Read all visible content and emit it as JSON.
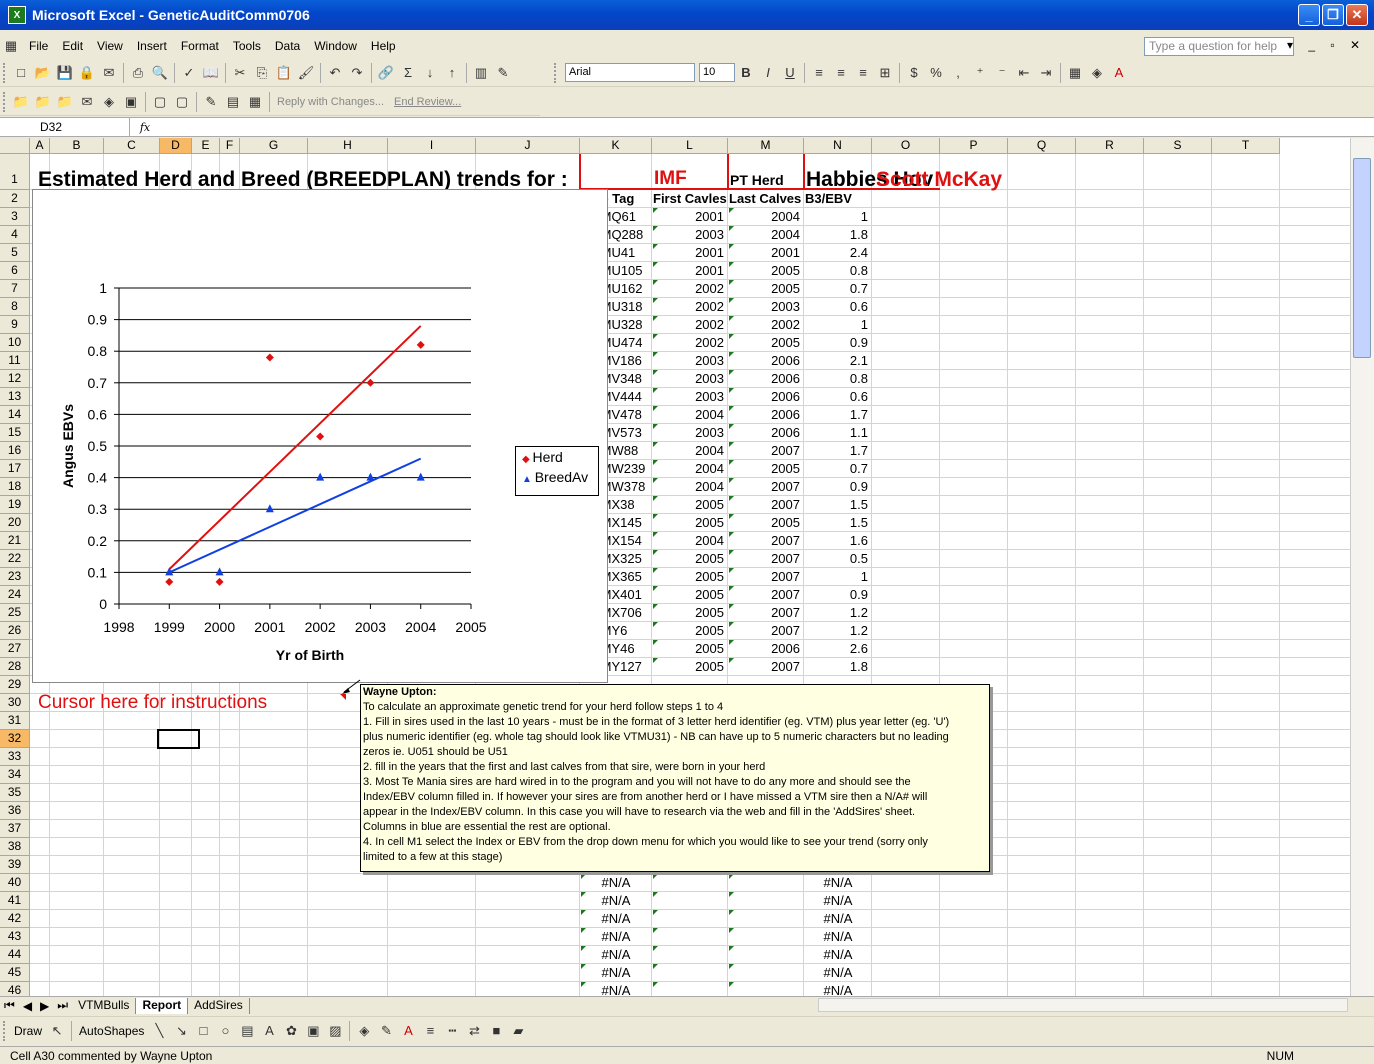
{
  "window": {
    "title": "Microsoft Excel - GeneticAuditComm0706"
  },
  "menu": [
    "File",
    "Edit",
    "View",
    "Insert",
    "Format",
    "Tools",
    "Data",
    "Window",
    "Help"
  ],
  "help_placeholder": "Type a question for help",
  "toolbar": {
    "font": "Arial",
    "size": "10",
    "reply_label": "Reply with Changes...",
    "end_review_label": "End Review..."
  },
  "formula": {
    "cell": "D32",
    "fx": "fx",
    "content": ""
  },
  "columns": [
    "A",
    "B",
    "C",
    "D",
    "E",
    "F",
    "G",
    "H",
    "I",
    "J",
    "K",
    "L",
    "M",
    "N",
    "O",
    "P",
    "Q",
    "R",
    "S",
    "T"
  ],
  "row_numbers": [
    "1",
    "2",
    "3",
    "4",
    "5",
    "6",
    "7",
    "8",
    "9",
    "10",
    "11",
    "12",
    "13",
    "14",
    "15",
    "16",
    "17",
    "18",
    "19",
    "20",
    "21",
    "22",
    "23",
    "24",
    "25",
    "26",
    "27",
    "28",
    "29",
    "30",
    "31",
    "32",
    "33",
    "34",
    "35",
    "36",
    "37",
    "38",
    "39",
    "40",
    "41",
    "42",
    "43",
    "44",
    "45",
    "46"
  ],
  "header_row": {
    "title": "Estimated Herd and Breed (BREEDPLAN) trends for :",
    "trait": "IMF",
    "pt_herd": "PT Herd",
    "herd_name": "Habbies Hov",
    "owner": "Scott McKay"
  },
  "row2": {
    "imf_small": "IMF",
    "sire_tag": "Sire Tag",
    "first": "First Cavles",
    "last": "Last Calves",
    "ebv": "B3/EBV"
  },
  "sires": [
    {
      "tag": "VTMQ61",
      "first": "2001",
      "last": "2004",
      "ebv": "1"
    },
    {
      "tag": "VTMQ288",
      "first": "2003",
      "last": "2004",
      "ebv": "1.8"
    },
    {
      "tag": "VTMU41",
      "first": "2001",
      "last": "2001",
      "ebv": "2.4"
    },
    {
      "tag": "VTMU105",
      "first": "2001",
      "last": "2005",
      "ebv": "0.8"
    },
    {
      "tag": "VTMU162",
      "first": "2002",
      "last": "2005",
      "ebv": "0.7"
    },
    {
      "tag": "VTMU318",
      "first": "2002",
      "last": "2003",
      "ebv": "0.6"
    },
    {
      "tag": "VTMU328",
      "first": "2002",
      "last": "2002",
      "ebv": "1"
    },
    {
      "tag": "VTMU474",
      "first": "2002",
      "last": "2005",
      "ebv": "0.9"
    },
    {
      "tag": "VTMV186",
      "first": "2003",
      "last": "2006",
      "ebv": "2.1"
    },
    {
      "tag": "VTMV348",
      "first": "2003",
      "last": "2006",
      "ebv": "0.8"
    },
    {
      "tag": "VTMV444",
      "first": "2003",
      "last": "2006",
      "ebv": "0.6"
    },
    {
      "tag": "VTMV478",
      "first": "2004",
      "last": "2006",
      "ebv": "1.7"
    },
    {
      "tag": "VTMV573",
      "first": "2003",
      "last": "2006",
      "ebv": "1.1"
    },
    {
      "tag": "VTMW88",
      "first": "2004",
      "last": "2007",
      "ebv": "1.7"
    },
    {
      "tag": "VTMW239",
      "first": "2004",
      "last": "2005",
      "ebv": "0.7"
    },
    {
      "tag": "VTMW378",
      "first": "2004",
      "last": "2007",
      "ebv": "0.9"
    },
    {
      "tag": "VTMX38",
      "first": "2005",
      "last": "2007",
      "ebv": "1.5"
    },
    {
      "tag": "VTMX145",
      "first": "2005",
      "last": "2005",
      "ebv": "1.5"
    },
    {
      "tag": "VTMX154",
      "first": "2004",
      "last": "2007",
      "ebv": "1.6"
    },
    {
      "tag": "VTMX325",
      "first": "2005",
      "last": "2007",
      "ebv": "0.5"
    },
    {
      "tag": "VTMX365",
      "first": "2005",
      "last": "2007",
      "ebv": "1"
    },
    {
      "tag": "VTMX401",
      "first": "2005",
      "last": "2007",
      "ebv": "0.9"
    },
    {
      "tag": "VTMX706",
      "first": "2005",
      "last": "2007",
      "ebv": "1.2"
    },
    {
      "tag": "VTMY6",
      "first": "2005",
      "last": "2007",
      "ebv": "1.2"
    },
    {
      "tag": "VTMY46",
      "first": "2005",
      "last": "2006",
      "ebv": "2.6"
    },
    {
      "tag": "VTMY127",
      "first": "2005",
      "last": "2007",
      "ebv": "1.8"
    }
  ],
  "na_rows": [
    "#N/A",
    "#N/A",
    "#N/A",
    "#N/A",
    "#N/A",
    "#N/A",
    "#N/A"
  ],
  "instructions_label": "Cursor here for instructions",
  "comment": {
    "author": "Wayne Upton:",
    "lines": [
      "To calculate an approximate genetic trend for your herd follow steps 1 to 4",
      "1. Fill in sires used in the last 10 years - must be in the format of 3 letter herd identifier (eg. VTM) plus year letter (eg. 'U')",
      "plus numeric identifier (eg. whole tag should look like VTMU31) - NB can have up to 5 numeric characters but no leading",
      "zeros ie. U051 should be U51",
      "2. fill in the years that the first and last calves from that sire, were born in your herd",
      "3. Most Te Mania sires are hard wired in to the program and you will not have to do any more and should see the",
      "Index/EBV column filled in.  If however your sires are from another herd or I have missed a VTM sire then a N/A# will",
      "appear in the Index/EBV column.  In this case you will have to research via the web and fill in the 'AddSires' sheet.",
      "Columns in blue are essential the rest are optional.",
      "4. In cell M1 select the Index or EBV from the drop down menu for which you would like to see your trend (sorry only",
      "limited to a few at this stage)"
    ]
  },
  "chart_data": {
    "type": "scatter",
    "ylabel": "Angus EBVs",
    "xlabel": "Yr of Birth",
    "xlim": [
      1998,
      2005
    ],
    "ylim": [
      0,
      1
    ],
    "xticks": [
      "1998",
      "1999",
      "2000",
      "2001",
      "2002",
      "2003",
      "2004",
      "2005"
    ],
    "yticks": [
      "0",
      "0.1",
      "0.2",
      "0.3",
      "0.4",
      "0.5",
      "0.6",
      "0.7",
      "0.8",
      "0.9",
      "1"
    ],
    "series": [
      {
        "name": "Herd",
        "color": "#e01010",
        "marker": "diamond",
        "points": [
          [
            1999,
            0.07
          ],
          [
            2000,
            0.07
          ],
          [
            2001,
            0.78
          ],
          [
            2002,
            0.53
          ],
          [
            2003,
            0.7
          ],
          [
            2004,
            0.82
          ]
        ],
        "trend": [
          [
            1999,
            0.11
          ],
          [
            2004,
            0.88
          ]
        ]
      },
      {
        "name": "BreedAv",
        "color": "#1040e0",
        "marker": "triangle",
        "points": [
          [
            1999,
            0.1
          ],
          [
            2000,
            0.1
          ],
          [
            2001,
            0.3
          ],
          [
            2002,
            0.4
          ],
          [
            2003,
            0.4
          ],
          [
            2004,
            0.4
          ]
        ],
        "trend": [
          [
            1999,
            0.1
          ],
          [
            2004,
            0.46
          ]
        ]
      }
    ],
    "legend": "right"
  },
  "tabs": [
    "VTMBulls",
    "Report",
    "AddSires"
  ],
  "active_tab": "Report",
  "drawbar": {
    "draw": "Draw",
    "autoshapes": "AutoShapes"
  },
  "status": {
    "text": "Cell A30 commented by Wayne Upton",
    "num": "NUM"
  }
}
